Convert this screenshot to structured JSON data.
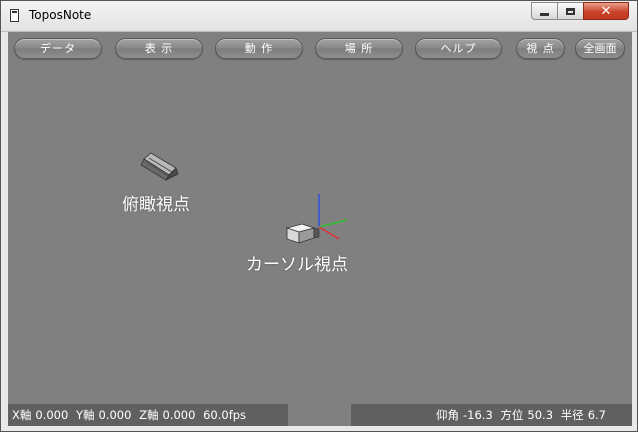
{
  "window": {
    "title": "ToposNote",
    "close_glyph": "✕"
  },
  "toolbar": {
    "data": "データ",
    "view": "表 示",
    "action": "動 作",
    "place": "場 所",
    "help": "ヘルプ",
    "viewpoint": "視 点",
    "fullscreen": "全画面"
  },
  "scene": {
    "overhead_label": "俯瞰視点",
    "cursor_label": "カーソル視点",
    "axis_colors": {
      "x": "#e03030",
      "y": "#30c030",
      "z": "#3050e0"
    }
  },
  "status": {
    "x_label": "X軸",
    "x_value": "0.000",
    "y_label": "Y軸",
    "y_value": "0.000",
    "z_label": "Z軸",
    "z_value": "0.000",
    "fps": "60.0fps",
    "elevation_label": "仰角",
    "elevation_value": "-16.3",
    "azimuth_label": "方位",
    "azimuth_value": "50.3",
    "radius_label": "半径",
    "radius_value": "6.7"
  }
}
